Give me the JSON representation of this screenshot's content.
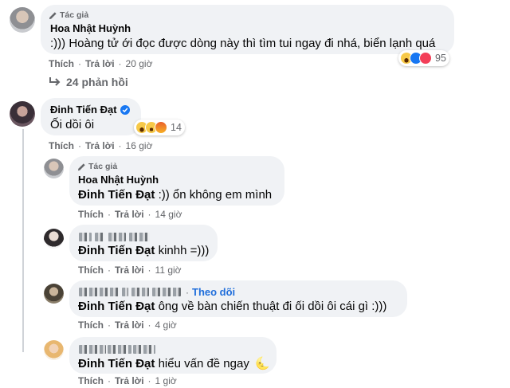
{
  "comments": [
    {
      "badge": "Tác giả",
      "author": "Hoa Nhật Huỳnh",
      "text": ":))) Hoàng tử ới đọc được dòng này thì tìm tui ngay đi nhá, biển lạnh quá",
      "actions": {
        "like": "Thích",
        "reply": "Trả lời",
        "time": "20 giờ"
      },
      "reaction_count": "95",
      "reaction_icons": [
        "haha-icon",
        "like-icon",
        "love-icon"
      ]
    },
    {
      "author": "Đinh Tiến Đạt",
      "verified": true,
      "text": "Ối dồi ôi",
      "actions": {
        "like": "Thích",
        "reply": "Trả lời",
        "time": "16 giờ"
      },
      "reaction_count": "14",
      "reaction_icons": [
        "haha-icon",
        "wow-icon",
        "angry-icon"
      ]
    }
  ],
  "view_replies": "24 phản hồi",
  "replies": [
    {
      "badge": "Tác giả",
      "author": "Hoa Nhật Huỳnh",
      "mention": "Đinh Tiến Đạt",
      "text": " :)) ổn không em mình",
      "actions": {
        "like": "Thích",
        "reply": "Trả lời",
        "time": "14 giờ"
      }
    },
    {
      "mention": "Đinh Tiến Đạt",
      "text": " kinhh =)))",
      "actions": {
        "like": "Thích",
        "reply": "Trả lời",
        "time": "11 giờ"
      }
    },
    {
      "follow": "Theo dõi",
      "mention": "Đinh Tiến Đạt",
      "text": " ông về bàn chiến thuật đi ối dồi ôi cái gì :)))",
      "actions": {
        "like": "Thích",
        "reply": "Trả lời",
        "time": "4 giờ"
      }
    },
    {
      "mention": "Đinh Tiến Đạt",
      "text": " hiểu vấn đề ngay",
      "emoji": "🌜",
      "actions": {
        "like": "Thích",
        "reply": "Trả lời",
        "time": "1 giờ"
      }
    }
  ],
  "colors": {
    "bubble": "#f0f2f5",
    "meta": "#65676b",
    "link": "#216fdb",
    "verified": "#1877f2"
  }
}
